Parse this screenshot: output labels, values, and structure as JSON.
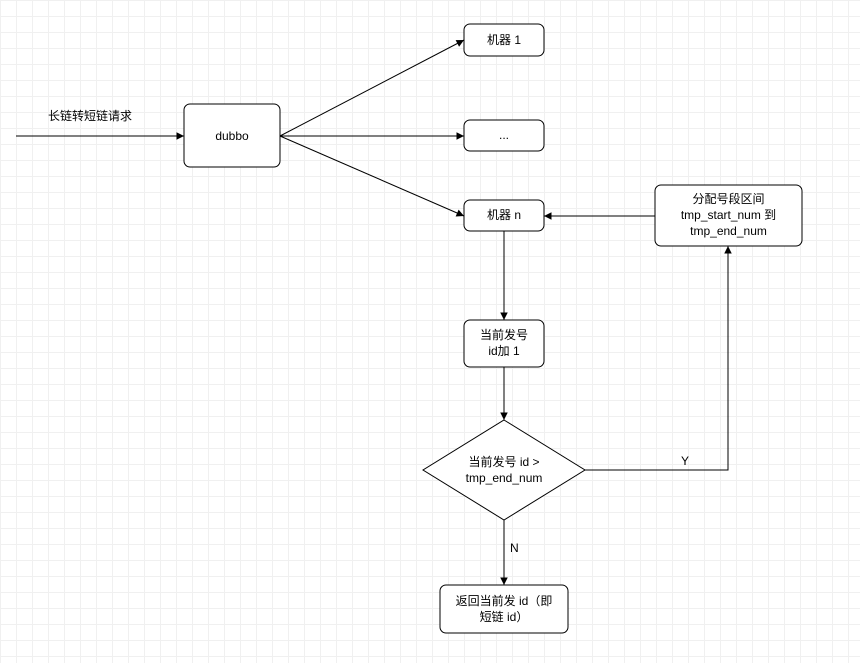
{
  "chart_data": {
    "type": "flowchart",
    "nodes": [
      {
        "id": "request_label",
        "type": "text",
        "text": "长链转短链请求"
      },
      {
        "id": "dubbo",
        "type": "process",
        "text": "dubbo"
      },
      {
        "id": "machine_1",
        "type": "process",
        "text": "机器 1"
      },
      {
        "id": "machine_ellipsis",
        "type": "process",
        "text": "..."
      },
      {
        "id": "machine_n",
        "type": "process",
        "text": "机器 n"
      },
      {
        "id": "allocate_range",
        "type": "process",
        "text": "分配号段区间\ntmp_start_num 到\ntmp_end_num"
      },
      {
        "id": "increment_id",
        "type": "process",
        "text": "当前发号\nid加 1"
      },
      {
        "id": "decision",
        "type": "decision",
        "text": "当前发号 id >\ntmp_end_num"
      },
      {
        "id": "return_id",
        "type": "process",
        "text": "返回当前发 id（即\n短链 id）"
      }
    ],
    "edges": [
      {
        "from": "request_label",
        "to": "dubbo"
      },
      {
        "from": "dubbo",
        "to": "machine_1"
      },
      {
        "from": "dubbo",
        "to": "machine_ellipsis"
      },
      {
        "from": "dubbo",
        "to": "machine_n"
      },
      {
        "from": "allocate_range",
        "to": "machine_n"
      },
      {
        "from": "machine_n",
        "to": "increment_id"
      },
      {
        "from": "increment_id",
        "to": "decision"
      },
      {
        "from": "decision",
        "to": "allocate_range",
        "label": "Y"
      },
      {
        "from": "decision",
        "to": "return_id",
        "label": "N"
      }
    ],
    "edge_labels": {
      "yes": "Y",
      "no": "N"
    }
  }
}
